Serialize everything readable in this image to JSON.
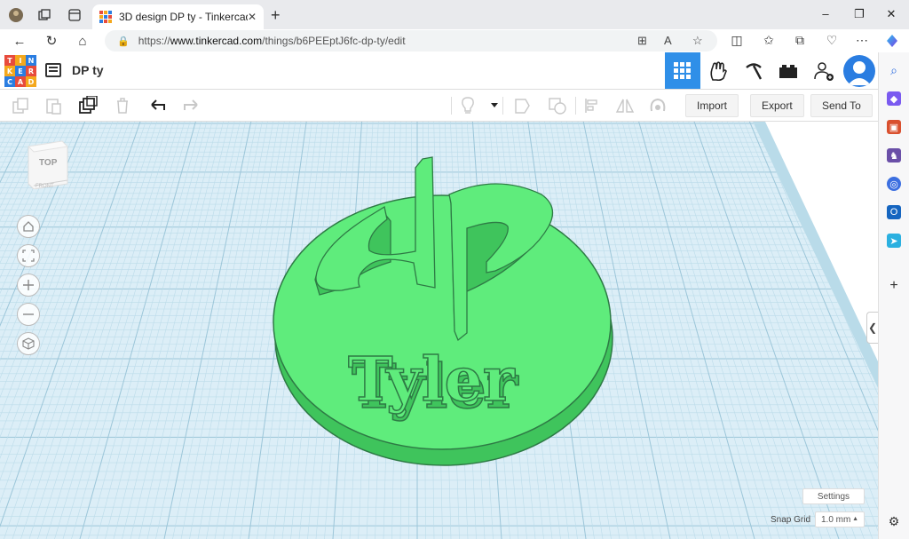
{
  "browser": {
    "tab_title": "3D design DP ty - Tinkercad",
    "url_prefix": "https://",
    "url_domain": "www.tinkercad.com",
    "url_path": "/things/b6PEEptJ6fc-dp-ty/edit"
  },
  "app": {
    "logo_letters": [
      "T",
      "I",
      "N",
      "K",
      "E",
      "R",
      "C",
      "A",
      "D"
    ],
    "logo_colors": [
      "#e84b3c",
      "#f4a81d",
      "#2a7de1",
      "#f4a81d",
      "#2a7de1",
      "#e84b3c",
      "#2a7de1",
      "#e84b3c",
      "#f4a81d"
    ],
    "design_title": "DP ty",
    "accent_color": "#2f8fe8"
  },
  "toolbar": {
    "import_label": "Import",
    "export_label": "Export",
    "send_to_label": "Send To"
  },
  "workplane": {
    "viewcube_top": "TOP",
    "viewcube_front": "FRONT",
    "model_text": "Tyler",
    "model_color": "#5fec7c",
    "settings_label": "Settings",
    "snap_grid_label": "Snap Grid",
    "snap_grid_value": "1.0 mm"
  }
}
